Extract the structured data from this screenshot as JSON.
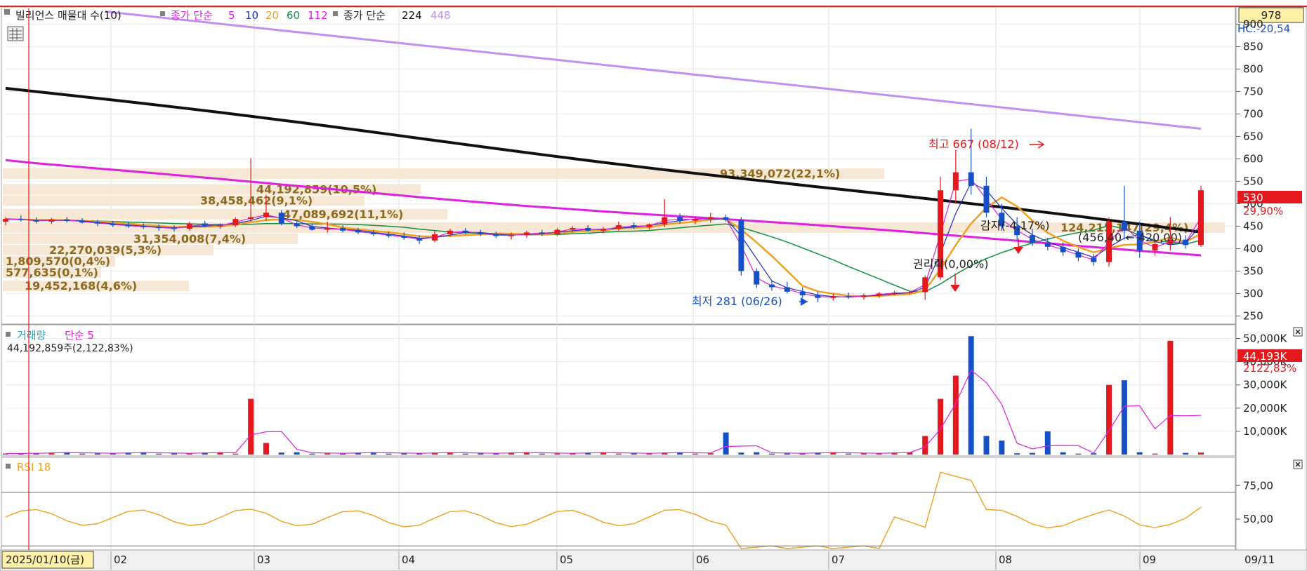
{
  "header": {
    "title": "빌리언스 매물대 수(10)",
    "ma_label": "종가 단순",
    "ma_periods": [
      "5",
      "10",
      "20",
      "60",
      "112"
    ],
    "ma2_label": "종가 단순",
    "ma2_periods": [
      "224",
      "448"
    ],
    "top_value": "978",
    "hc_label": "HC:-20,54"
  },
  "colors": {
    "up": "#e5191d",
    "down": "#1650c8",
    "ma5": "#e020e0",
    "ma10": "#2030c0",
    "ma20": "#f0a020",
    "ma60": "#109040",
    "ma112": "#e020e0",
    "ma224": "#101010",
    "ma448": "#c090f0",
    "rsi": "#f0a020",
    "profile": "#f5e6d0",
    "profile_text": "#8a6a20",
    "price_badge": "#e5191d"
  },
  "volume_profile": [
    {
      "label": "93,349,072(22,1%)",
      "price": 555
    },
    {
      "label": "44,192,859(10,5%)",
      "price": 520
    },
    {
      "label": "38,458,462(9,1%)",
      "price": 495
    },
    {
      "label": "47,089,692(11,1%)",
      "price": 465
    },
    {
      "label": "124,215,147(29,4%)",
      "price": 435
    },
    {
      "label": "31,354,008(7,4%)",
      "price": 410
    },
    {
      "label": "22,270,039(5,3%)",
      "price": 385
    },
    {
      "label": "1,809,570(0,4%)",
      "price": 360
    },
    {
      "label": "577,635(0,1%)",
      "price": 335
    },
    {
      "label": "19,452,168(4,6%)",
      "price": 305
    }
  ],
  "annotations": {
    "high": "최고 667 (08/12)",
    "low": "최저 281 (06/26)",
    "rights": "권리락(0,00%)",
    "reduction": "감자(-4,17%)",
    "range": "(456,40 ← 420,00)"
  },
  "price_axis": {
    "ticks": [
      "900",
      "850",
      "800",
      "750",
      "700",
      "650",
      "600",
      "550",
      "500",
      "450",
      "400",
      "350",
      "300",
      "250"
    ],
    "current": "530",
    "current_change": "29,90%"
  },
  "volume_panel": {
    "title": "거래량",
    "ma": "단순 5",
    "info": "44,192,859주(2,122,83%)",
    "ticks": [
      "50,000K",
      "40,000K",
      "30,000K",
      "20,000K",
      "10,000K"
    ],
    "current": "44,193K",
    "current_change": "2122,83%"
  },
  "rsi_panel": {
    "title": "RSI 18",
    "ticks": [
      "75,00",
      "50,00"
    ]
  },
  "x_axis": {
    "start_label": "2025/01/10(금)",
    "months": [
      "02",
      "03",
      "04",
      "05",
      "06",
      "07",
      "08",
      "09"
    ],
    "end_label": "09/11"
  },
  "chart_data": {
    "type": "candlestick",
    "start_date": "2025/01/10",
    "end_date": "2025/09/11",
    "price_ylim": [
      235,
      935
    ],
    "ohlc_sample": [
      {
        "o": 460,
        "h": 470,
        "l": 452,
        "c": 466
      },
      {
        "o": 466,
        "h": 474,
        "l": 460,
        "c": 464
      },
      {
        "o": 464,
        "h": 470,
        "l": 456,
        "c": 460
      },
      {
        "o": 460,
        "h": 468,
        "l": 455,
        "c": 465
      },
      {
        "o": 465,
        "h": 470,
        "l": 458,
        "c": 462
      },
      {
        "o": 462,
        "h": 468,
        "l": 456,
        "c": 458
      },
      {
        "o": 458,
        "h": 464,
        "l": 450,
        "c": 456
      },
      {
        "o": 456,
        "h": 462,
        "l": 448,
        "c": 452
      },
      {
        "o": 452,
        "h": 460,
        "l": 446,
        "c": 450
      },
      {
        "o": 450,
        "h": 456,
        "l": 444,
        "c": 448
      },
      {
        "o": 448,
        "h": 454,
        "l": 440,
        "c": 446
      },
      {
        "o": 446,
        "h": 452,
        "l": 438,
        "c": 444
      },
      {
        "o": 444,
        "h": 460,
        "l": 440,
        "c": 456
      },
      {
        "o": 456,
        "h": 462,
        "l": 448,
        "c": 450
      },
      {
        "o": 450,
        "h": 456,
        "l": 444,
        "c": 452
      },
      {
        "o": 452,
        "h": 470,
        "l": 448,
        "c": 466
      },
      {
        "o": 466,
        "h": 601,
        "l": 460,
        "c": 470
      },
      {
        "o": 470,
        "h": 520,
        "l": 462,
        "c": 480
      },
      {
        "o": 480,
        "h": 486,
        "l": 452,
        "c": 456
      },
      {
        "o": 456,
        "h": 462,
        "l": 446,
        "c": 450
      },
      {
        "o": 450,
        "h": 456,
        "l": 440,
        "c": 442
      },
      {
        "o": 442,
        "h": 460,
        "l": 436,
        "c": 446
      },
      {
        "o": 446,
        "h": 452,
        "l": 436,
        "c": 440
      },
      {
        "o": 440,
        "h": 446,
        "l": 432,
        "c": 436
      },
      {
        "o": 436,
        "h": 442,
        "l": 428,
        "c": 432
      },
      {
        "o": 432,
        "h": 438,
        "l": 424,
        "c": 428
      },
      {
        "o": 428,
        "h": 436,
        "l": 420,
        "c": 424
      },
      {
        "o": 424,
        "h": 430,
        "l": 410,
        "c": 418
      },
      {
        "o": 418,
        "h": 440,
        "l": 414,
        "c": 432
      },
      {
        "o": 432,
        "h": 444,
        "l": 426,
        "c": 440
      },
      {
        "o": 440,
        "h": 446,
        "l": 432,
        "c": 436
      },
      {
        "o": 436,
        "h": 442,
        "l": 428,
        "c": 432
      },
      {
        "o": 432,
        "h": 438,
        "l": 424,
        "c": 428
      },
      {
        "o": 428,
        "h": 436,
        "l": 420,
        "c": 430
      },
      {
        "o": 430,
        "h": 440,
        "l": 424,
        "c": 436
      },
      {
        "o": 436,
        "h": 442,
        "l": 428,
        "c": 432
      },
      {
        "o": 432,
        "h": 446,
        "l": 428,
        "c": 442
      },
      {
        "o": 442,
        "h": 450,
        "l": 436,
        "c": 446
      },
      {
        "o": 446,
        "h": 452,
        "l": 438,
        "c": 440
      },
      {
        "o": 440,
        "h": 448,
        "l": 434,
        "c": 444
      },
      {
        "o": 444,
        "h": 460,
        "l": 440,
        "c": 452
      },
      {
        "o": 452,
        "h": 458,
        "l": 444,
        "c": 448
      },
      {
        "o": 448,
        "h": 456,
        "l": 442,
        "c": 454
      },
      {
        "o": 454,
        "h": 510,
        "l": 448,
        "c": 470
      },
      {
        "o": 470,
        "h": 478,
        "l": 456,
        "c": 462
      },
      {
        "o": 462,
        "h": 470,
        "l": 454,
        "c": 466
      },
      {
        "o": 466,
        "h": 480,
        "l": 458,
        "c": 470
      },
      {
        "o": 470,
        "h": 476,
        "l": 460,
        "c": 464
      },
      {
        "o": 464,
        "h": 470,
        "l": 340,
        "c": 350
      },
      {
        "o": 350,
        "h": 356,
        "l": 312,
        "c": 320
      },
      {
        "o": 320,
        "h": 330,
        "l": 306,
        "c": 314
      },
      {
        "o": 314,
        "h": 326,
        "l": 300,
        "c": 304
      },
      {
        "o": 304,
        "h": 314,
        "l": 290,
        "c": 296
      },
      {
        "o": 296,
        "h": 304,
        "l": 281,
        "c": 290
      },
      {
        "o": 290,
        "h": 300,
        "l": 284,
        "c": 294
      },
      {
        "o": 294,
        "h": 302,
        "l": 288,
        "c": 292
      },
      {
        "o": 292,
        "h": 300,
        "l": 286,
        "c": 296
      },
      {
        "o": 296,
        "h": 304,
        "l": 290,
        "c": 300
      },
      {
        "o": 300,
        "h": 306,
        "l": 296,
        "c": 302
      },
      {
        "o": 302,
        "h": 306,
        "l": 298,
        "c": 303
      },
      {
        "o": 303,
        "h": 340,
        "l": 286,
        "c": 336
      },
      {
        "o": 336,
        "h": 560,
        "l": 330,
        "c": 530
      },
      {
        "o": 530,
        "h": 620,
        "l": 500,
        "c": 570
      },
      {
        "o": 570,
        "h": 667,
        "l": 520,
        "c": 540
      },
      {
        "o": 540,
        "h": 560,
        "l": 470,
        "c": 480
      },
      {
        "o": 480,
        "h": 500,
        "l": 440,
        "c": 450
      },
      {
        "o": 450,
        "h": 470,
        "l": 420,
        "c": 430
      },
      {
        "o": 430,
        "h": 444,
        "l": 406,
        "c": 412
      },
      {
        "o": 412,
        "h": 424,
        "l": 396,
        "c": 404
      },
      {
        "o": 404,
        "h": 414,
        "l": 384,
        "c": 392
      },
      {
        "o": 392,
        "h": 400,
        "l": 372,
        "c": 380
      },
      {
        "o": 380,
        "h": 388,
        "l": 362,
        "c": 370
      },
      {
        "o": 370,
        "h": 470,
        "l": 360,
        "c": 460
      },
      {
        "o": 460,
        "h": 540,
        "l": 420,
        "c": 440
      },
      {
        "o": 440,
        "h": 460,
        "l": 380,
        "c": 396
      },
      {
        "o": 396,
        "h": 420,
        "l": 384,
        "c": 410
      },
      {
        "o": 410,
        "h": 470,
        "l": 396,
        "c": 420
      },
      {
        "o": 420,
        "h": 430,
        "l": 400,
        "c": 408
      },
      {
        "o": 408,
        "h": 540,
        "l": 404,
        "c": 530
      }
    ],
    "ma_lines": {
      "ma224": {
        "start": 757,
        "end": 435
      },
      "ma448": {
        "start": 928,
        "end": 667
      },
      "ma112": {
        "start": 597,
        "end": 388
      }
    },
    "volume_ylim": [
      0,
      55000
    ],
    "volume_current": 44193,
    "rsi_ylim": [
      28,
      92
    ],
    "rsi_levels": [
      70,
      30
    ]
  }
}
